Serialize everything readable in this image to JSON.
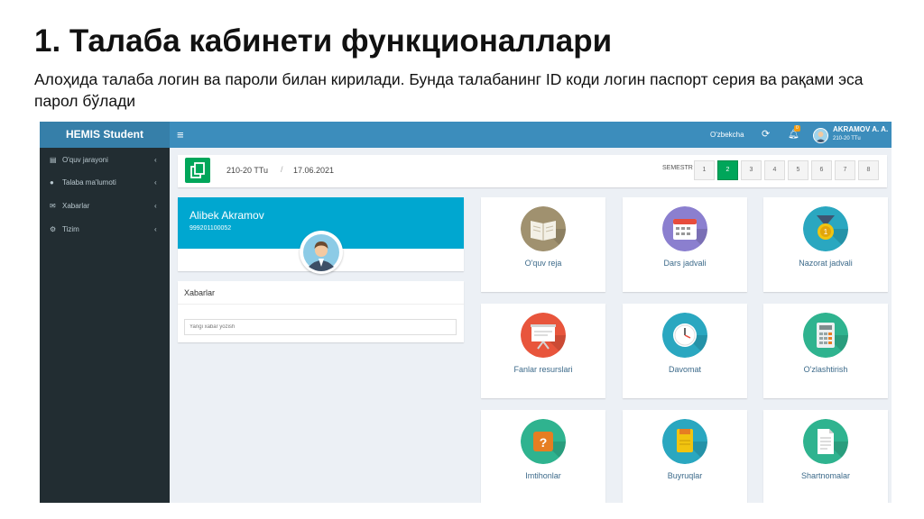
{
  "slide": {
    "title": "1. Талаба кабинети функционаллари",
    "text": "Алоҳида талаба логин ва пароли билан кирилади. Бунда талабанинг ID коди логин паспорт серия ва рақами эса парол бўлади"
  },
  "header": {
    "brand": "HEMIS Student",
    "menu_icon": "≡",
    "language": "O'zbekcha",
    "notification_count": "0",
    "user_name": "AKRAMOV A. A.",
    "user_group": "210-20 TTu"
  },
  "sidebar": {
    "items": [
      {
        "label": "O'quv jarayoni",
        "icon": "book-icon"
      },
      {
        "label": "Talaba ma'lumoti",
        "icon": "user-icon"
      },
      {
        "label": "Xabarlar",
        "icon": "envelope-icon"
      },
      {
        "label": "Tizim",
        "icon": "gear-icon"
      }
    ]
  },
  "semester_bar": {
    "group": "210-20 TTu",
    "separator": "/",
    "date": "17.06.2021",
    "label": "SEMESTR",
    "semesters": [
      "1",
      "2",
      "3",
      "4",
      "5",
      "6",
      "7",
      "8"
    ],
    "active": "2"
  },
  "profile": {
    "name": "Alibek Akramov",
    "id": "999201100052"
  },
  "news": {
    "title": "Xabarlar",
    "placeholder": "Yangi xabar yozish"
  },
  "tiles": [
    {
      "label": "O'quv reja",
      "icon": "book-icon"
    },
    {
      "label": "Dars jadvali",
      "icon": "calendar-icon"
    },
    {
      "label": "Nazorat jadvali",
      "icon": "medal-icon"
    },
    {
      "label": "Fanlar resurslari",
      "icon": "presentation-icon"
    },
    {
      "label": "Davomat",
      "icon": "clock-icon"
    },
    {
      "label": "O'zlashtirish",
      "icon": "calculator-icon"
    },
    {
      "label": "Imtihonlar",
      "icon": "question-icon"
    },
    {
      "label": "Buyruqlar",
      "icon": "folder-icon"
    },
    {
      "label": "Shartnomalar",
      "icon": "document-icon"
    }
  ],
  "colors": {
    "header": "#3c8dbc",
    "brand": "#367fa9",
    "sidebar": "#222d32",
    "accent_green": "#00a65a",
    "profile_blue": "#00a7d0",
    "content_bg": "#ecf0f5"
  }
}
